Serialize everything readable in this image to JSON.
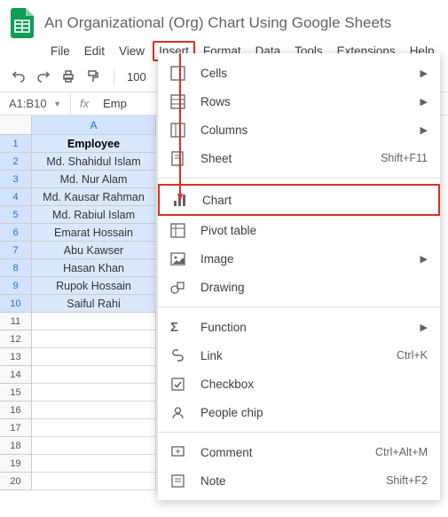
{
  "doc": {
    "title": "An Organizational (Org) Chart Using Google Sheets"
  },
  "menubar": [
    "File",
    "Edit",
    "View",
    "Insert",
    "Format",
    "Data",
    "Tools",
    "Extensions",
    "Help"
  ],
  "active_menu": "Insert",
  "toolbar": {
    "zoom": "100"
  },
  "namebox": "A1:B10",
  "formula": "Emp",
  "col_header": "A",
  "rows": [
    "1",
    "2",
    "3",
    "4",
    "5",
    "6",
    "7",
    "8",
    "9",
    "10",
    "11",
    "12",
    "13",
    "14",
    "15",
    "16",
    "17",
    "18",
    "19",
    "20"
  ],
  "cells": [
    "Employee",
    "Md. Shahidul Islam",
    "Md. Nur Alam",
    "Md. Kausar Rahman",
    "Md. Rabiul Islam",
    "Emarat Hossain",
    "Abu Kawser",
    "Hasan Khan",
    "Rupok Hossain",
    "Saiful Rahi"
  ],
  "dropdown": {
    "g1": [
      {
        "label": "Cells",
        "arrow": true
      },
      {
        "label": "Rows",
        "arrow": true
      },
      {
        "label": "Columns",
        "arrow": true
      },
      {
        "label": "Sheet",
        "shortcut": "Shift+F11"
      }
    ],
    "g2": [
      {
        "label": "Chart",
        "hl": true
      },
      {
        "label": "Pivot table"
      },
      {
        "label": "Image",
        "arrow": true
      },
      {
        "label": "Drawing"
      }
    ],
    "g3": [
      {
        "label": "Function",
        "arrow": true
      },
      {
        "label": "Link",
        "shortcut": "Ctrl+K"
      },
      {
        "label": "Checkbox"
      },
      {
        "label": "People chip"
      }
    ],
    "g4": [
      {
        "label": "Comment",
        "shortcut": "Ctrl+Alt+M"
      },
      {
        "label": "Note",
        "shortcut": "Shift+F2"
      }
    ]
  }
}
